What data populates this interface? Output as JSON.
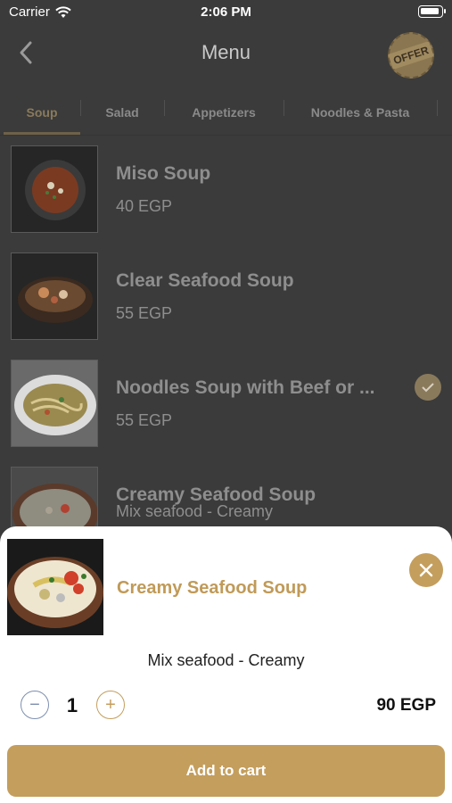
{
  "status": {
    "carrier": "Carrier",
    "time": "2:06 PM"
  },
  "nav": {
    "title": "Menu",
    "offer_badge": "OFFER"
  },
  "tabs": [
    {
      "label": "Soup",
      "active": true
    },
    {
      "label": "Salad",
      "active": false
    },
    {
      "label": "Appetizers",
      "active": false
    },
    {
      "label": "Noodles & Pasta",
      "active": false
    }
  ],
  "items": [
    {
      "name": "Miso Soup",
      "price": "40 EGP",
      "selected": false
    },
    {
      "name": "Clear Seafood Soup",
      "price": "55 EGP",
      "selected": false
    },
    {
      "name": "Noodles Soup with Beef or ...",
      "price": "55 EGP",
      "selected": true
    },
    {
      "name": "Creamy Seafood Soup",
      "price": "Mix seafood - Creamy",
      "selected": false
    }
  ],
  "sheet": {
    "title": "Creamy Seafood Soup",
    "description": "Mix seafood - Creamy",
    "minus": "−",
    "plus": "+",
    "quantity": "1",
    "total": "90 EGP",
    "add_label": "Add to cart"
  },
  "colors": {
    "accent": "#c49e5d",
    "background": "#3b3b3b"
  },
  "icons": [
    "wifi-icon",
    "battery-icon",
    "back-arrow-icon",
    "check-icon",
    "close-icon",
    "minus-icon",
    "plus-icon"
  ]
}
